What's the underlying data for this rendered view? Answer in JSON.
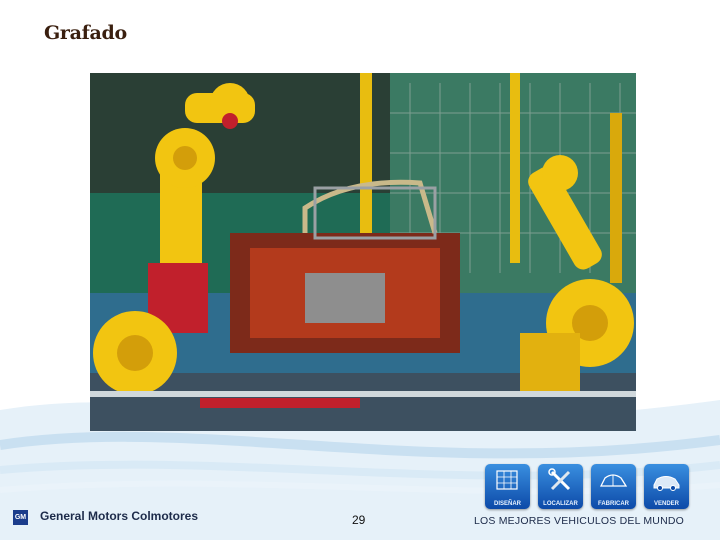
{
  "slide": {
    "title": "Grafado",
    "page_number": "29",
    "company": "General Motors Colmotores",
    "logo_text": "GM",
    "tagline": "LOS MEJORES VEHICULOS DEL MUNDO"
  },
  "video": {
    "controls": {
      "rewind": "↻",
      "loop": "⟲",
      "stop": "■",
      "prev": "◀◀",
      "play": "▶",
      "volume": "◄)"
    }
  },
  "nav": {
    "items": [
      {
        "label": "DISEÑAR",
        "icon": "blueprint-icon"
      },
      {
        "label": "LOCALIZAR",
        "icon": "tools-icon"
      },
      {
        "label": "FABRICAR",
        "icon": "car-body-icon"
      },
      {
        "label": "VENDER",
        "icon": "car-icon"
      }
    ]
  },
  "colors": {
    "title": "#3a1f0f",
    "nav_blue": "#0d4aa8",
    "robot_yellow": "#f2c511",
    "machine_green": "#1a5a4a"
  }
}
